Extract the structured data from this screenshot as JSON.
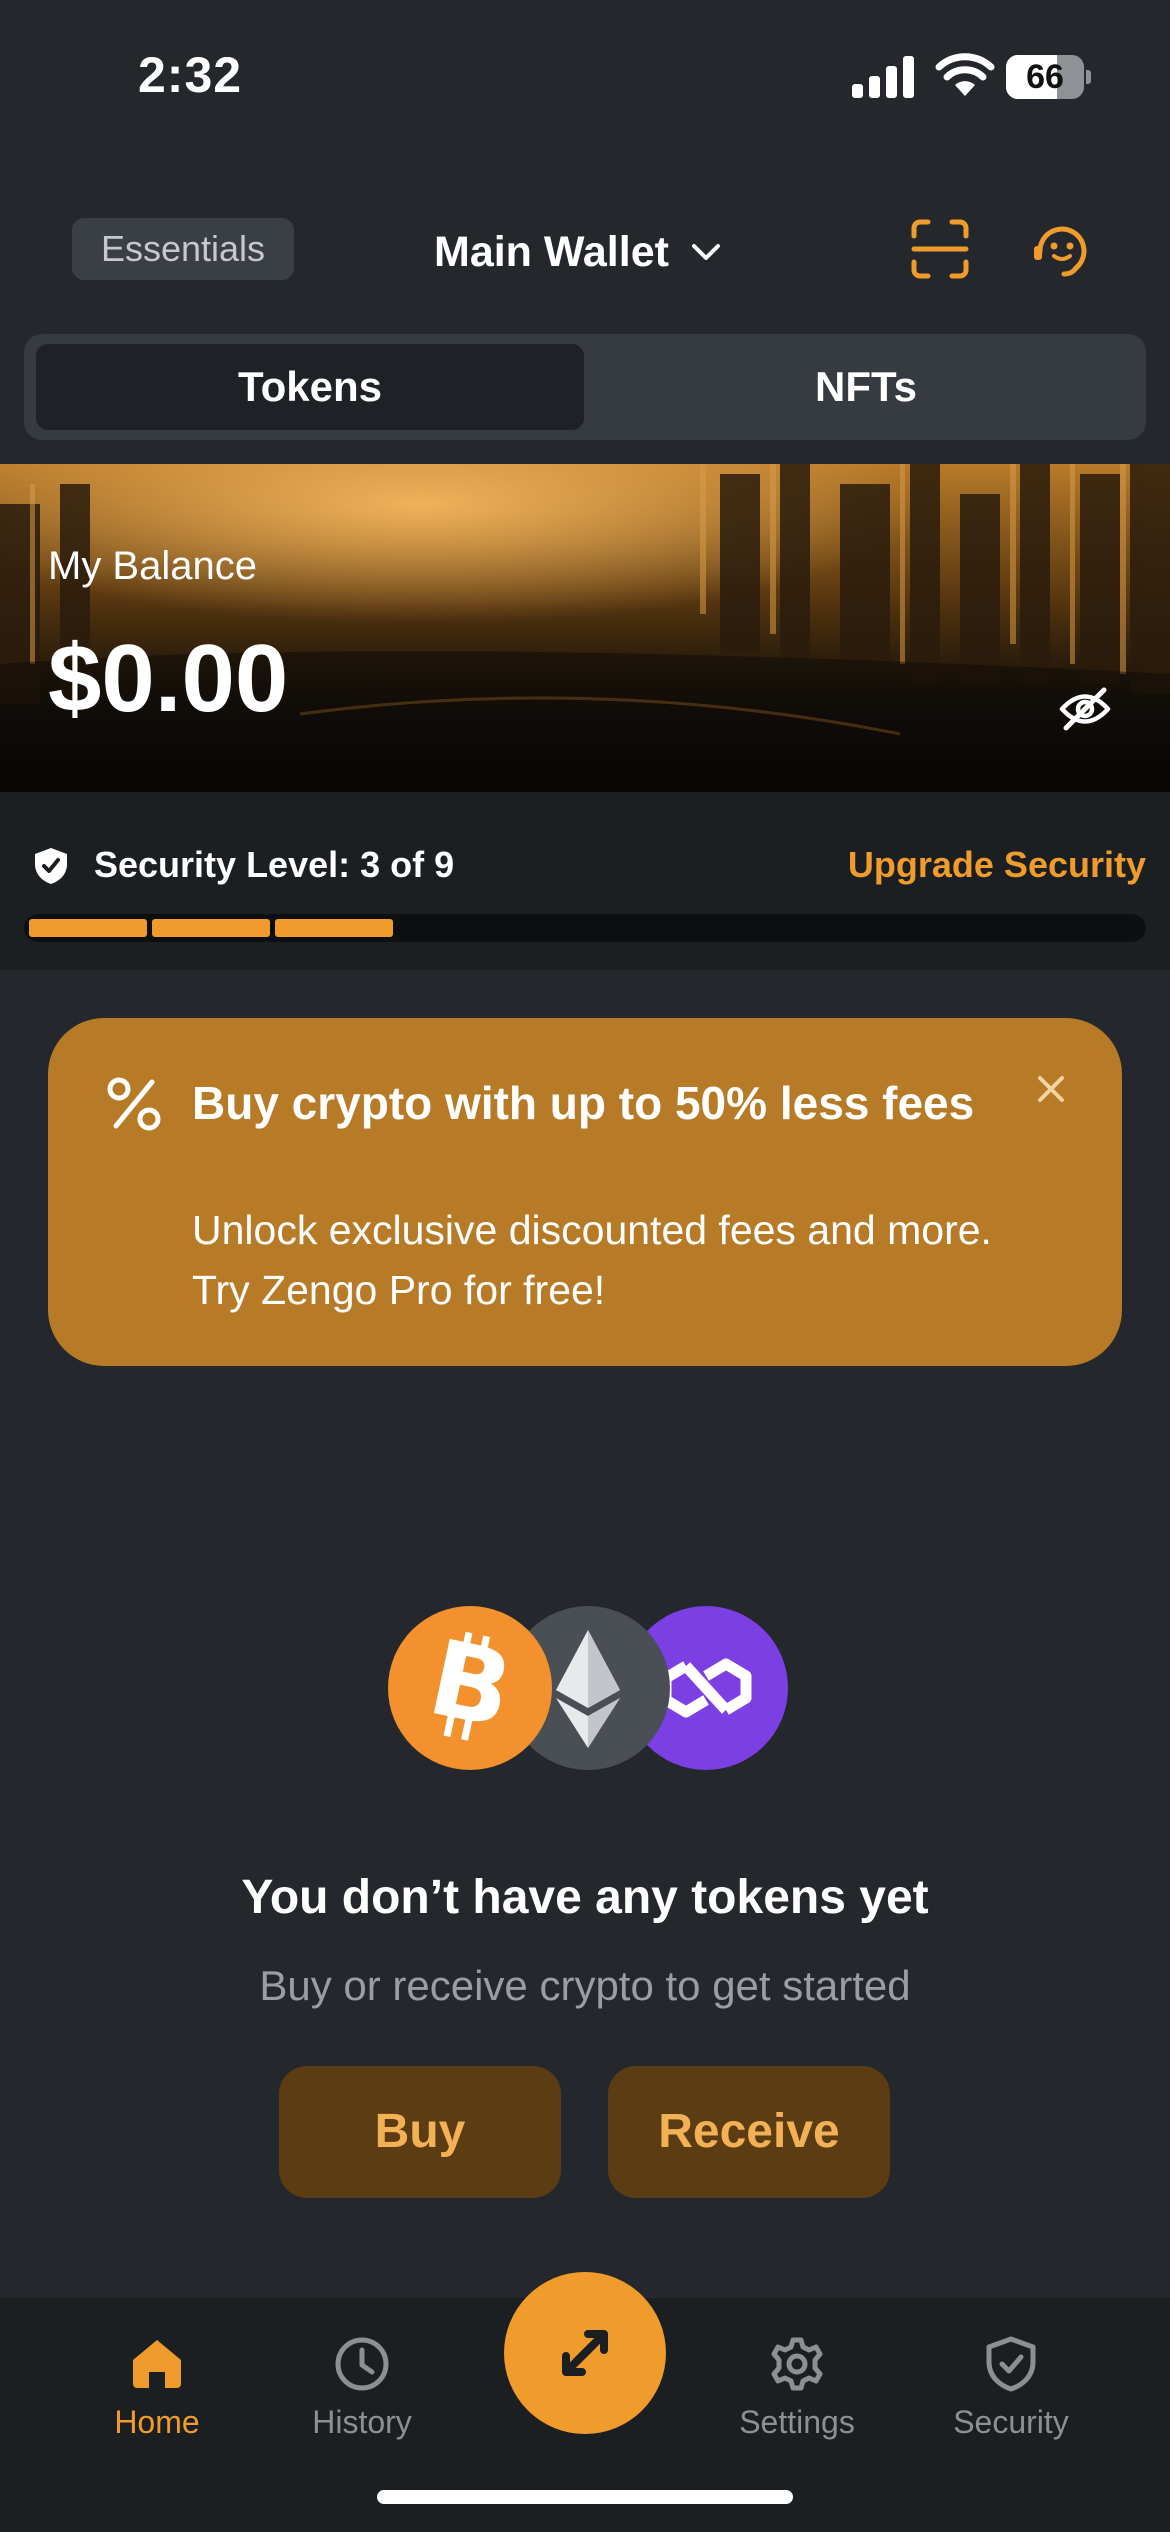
{
  "status_bar": {
    "time": "2:32",
    "battery": "66",
    "battery_level": 0.66
  },
  "header": {
    "essentials_label": "Essentials",
    "wallet_name": "Main Wallet",
    "icons": {
      "scan": "scan-icon",
      "support": "support-agent-icon",
      "dropdown": "chevron-down-icon"
    }
  },
  "tabs": [
    {
      "label": "Tokens",
      "selected": true
    },
    {
      "label": "NFTs",
      "selected": false
    }
  ],
  "balance": {
    "label": "My Balance",
    "amount": "$0.00",
    "hide_icon": "eye-off-icon"
  },
  "security": {
    "level_text": "Security Level: 3 of 9",
    "upgrade_label": "Upgrade Security",
    "level": 3,
    "max": 9
  },
  "promo": {
    "title": "Buy crypto with up to 50% less fees",
    "body": "Unlock exclusive discounted fees and more. Try Zengo Pro for free!",
    "icon": "percent-icon",
    "close_icon": "close-icon"
  },
  "empty_state": {
    "coins": [
      "bitcoin-icon",
      "ethereum-icon",
      "polygon-icon"
    ],
    "title": "You don’t have any tokens yet",
    "subtitle": "Buy or receive crypto to get started",
    "buy_label": "Buy",
    "receive_label": "Receive"
  },
  "bottom_nav": {
    "items": [
      {
        "label": "Home",
        "icon": "home-icon",
        "active": true
      },
      {
        "label": "History",
        "icon": "clock-icon",
        "active": false
      },
      {
        "label": "Settings",
        "icon": "gear-icon",
        "active": false
      },
      {
        "label": "Security",
        "icon": "shield-icon",
        "active": false
      }
    ],
    "swap_icon": "swap-arrows-icon"
  },
  "colors": {
    "accent": "#ef9c2d",
    "background": "#24282c",
    "promo": "#b77b27",
    "button_bg": "#5c3c12",
    "bitcoin": "#f2912e",
    "ethereum": "#4a4f55",
    "polygon": "#7b3fe4"
  }
}
